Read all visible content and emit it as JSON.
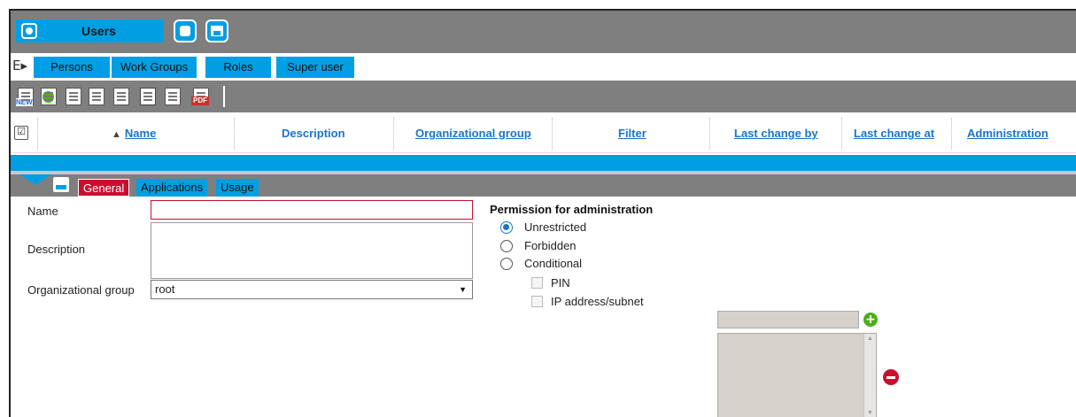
{
  "titlebar": {
    "title": "Users",
    "title_icon": "users-icon",
    "buttons": [
      "view-icon",
      "save-icon"
    ]
  },
  "nav": {
    "toggle_glyph": "E▸",
    "tabs": [
      "Persons",
      "Work Groups",
      "Roles",
      "Super user"
    ]
  },
  "toolbar": {
    "new_text": "NEW",
    "pdf_text": "PDF",
    "tools": [
      "new-icon",
      "add-icon",
      "edit-icon",
      "copy-icon",
      "duplicate-icon",
      "delete-icon",
      "settings-icon",
      "pdf-icon"
    ]
  },
  "table": {
    "select_all_glyph": "☑",
    "sort_glyph": "▲",
    "columns": [
      "Name",
      "Description",
      "Organizational group",
      "Filter",
      "Last change by",
      "Last change at",
      "Administration"
    ]
  },
  "detail_tabs": [
    "General",
    "Applications",
    "Usage"
  ],
  "form": {
    "name_label": "Name",
    "name_value": "",
    "description_label": "Description",
    "description_value": "",
    "org_group_label": "Organizational group",
    "org_group_value": "root",
    "permission_title": "Permission for administration",
    "options": [
      "Unrestricted",
      "Forbidden",
      "Conditional"
    ],
    "selected_option": "Unrestricted",
    "conditions": [
      "PIN",
      "IP address/subnet"
    ],
    "add_glyph": "+"
  },
  "colors": {
    "accent": "#009fe3",
    "header_gray": "#7f7f7f",
    "active_tab": "#c8102e",
    "link": "#1a75c8",
    "add_green": "#4caf1a"
  }
}
